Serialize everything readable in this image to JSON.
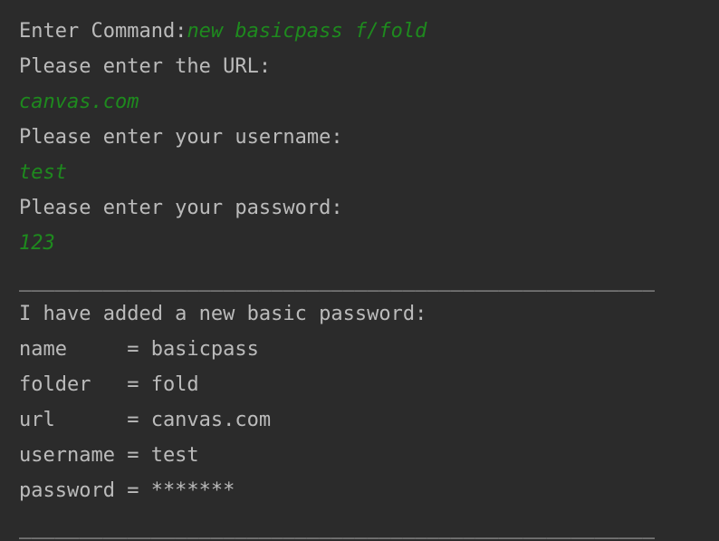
{
  "console": {
    "prompt_label": "Enter Command:",
    "command_input": "new basicpass f/fold",
    "url_prompt": "Please enter the URL:",
    "url_input": "canvas.com",
    "username_prompt": "Please enter your username:",
    "username_input": "test",
    "password_prompt": "Please enter your password:",
    "password_input": "123",
    "separator": "_____________________________________________________",
    "confirmation": "I have added a new basic password:",
    "fields": [
      {
        "text": "name     = basicpass"
      },
      {
        "text": "folder   = fold"
      },
      {
        "text": "url      = canvas.com"
      },
      {
        "text": "username = test"
      },
      {
        "text": "password = *******"
      }
    ],
    "separator_bottom": "_____________________________________________________"
  },
  "colors": {
    "background": "#2b2b2b",
    "output_text": "#bbbbbb",
    "user_input": "#1e8a1e"
  }
}
